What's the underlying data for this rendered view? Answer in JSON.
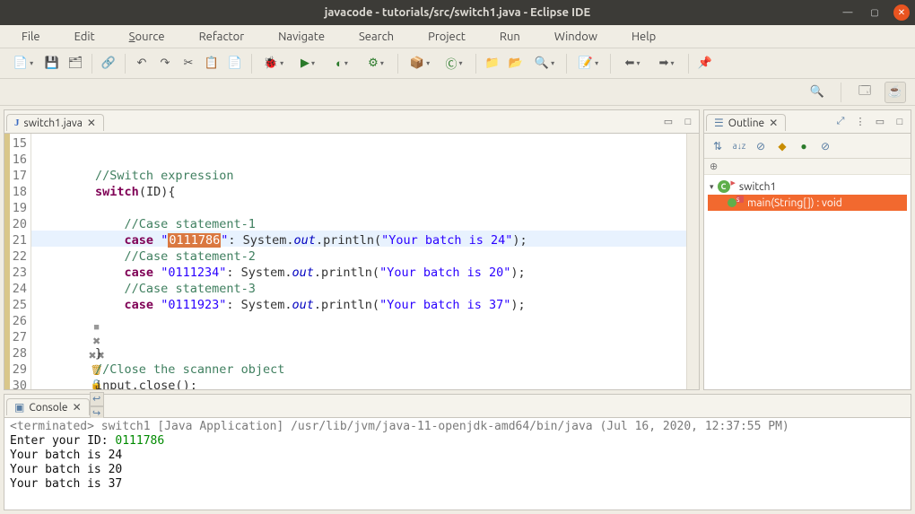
{
  "window": {
    "title": "javacode - tutorials/src/switch1.java - Eclipse IDE"
  },
  "menubar": {
    "file": "File",
    "edit": "Edit",
    "source": "Source",
    "refactor": "Refactor",
    "navigate": "Navigate",
    "search": "Search",
    "project": "Project",
    "run": "Run",
    "window": "Window",
    "help": "Help"
  },
  "editor": {
    "tab_filename": "switch1.java",
    "line_numbers": [
      "15",
      "16",
      "17",
      "18",
      "19",
      "20",
      "21",
      "22",
      "23",
      "24",
      "25",
      "26",
      "27",
      "28",
      "29",
      "30"
    ],
    "code_lines": [
      {
        "indent": "",
        "segments": []
      },
      {
        "indent": "",
        "segments": []
      },
      {
        "indent": "        ",
        "segments": [
          {
            "cls": "c-comm",
            "text": "//Switch expression"
          }
        ]
      },
      {
        "indent": "        ",
        "segments": [
          {
            "cls": "c-kw",
            "text": "switch"
          },
          {
            "cls": "",
            "text": "(ID){"
          }
        ]
      },
      {
        "indent": "",
        "segments": []
      },
      {
        "indent": "            ",
        "segments": [
          {
            "cls": "c-comm",
            "text": "//Case statement-1"
          }
        ]
      },
      {
        "indent": "            ",
        "segments": [
          {
            "cls": "c-kw",
            "text": "case"
          },
          {
            "cls": "",
            "text": " "
          },
          {
            "cls": "c-str",
            "text": "\""
          },
          {
            "cls": "c-sel",
            "text": "0111786"
          },
          {
            "cls": "c-str",
            "text": "\""
          },
          {
            "cls": "",
            "text": ": System."
          },
          {
            "cls": "c-field",
            "text": "out"
          },
          {
            "cls": "",
            "text": ".println("
          },
          {
            "cls": "c-str",
            "text": "\"Your batch is 24\""
          },
          {
            "cls": "",
            "text": ");"
          }
        ]
      },
      {
        "indent": "            ",
        "segments": [
          {
            "cls": "c-comm",
            "text": "//Case statement-2"
          }
        ]
      },
      {
        "indent": "            ",
        "segments": [
          {
            "cls": "c-kw",
            "text": "case"
          },
          {
            "cls": "",
            "text": " "
          },
          {
            "cls": "c-str",
            "text": "\"0111234\""
          },
          {
            "cls": "",
            "text": ": System."
          },
          {
            "cls": "c-field",
            "text": "out"
          },
          {
            "cls": "",
            "text": ".println("
          },
          {
            "cls": "c-str",
            "text": "\"Your batch is 20\""
          },
          {
            "cls": "",
            "text": ");"
          }
        ]
      },
      {
        "indent": "            ",
        "segments": [
          {
            "cls": "c-comm",
            "text": "//Case statement-3"
          }
        ]
      },
      {
        "indent": "            ",
        "segments": [
          {
            "cls": "c-kw",
            "text": "case"
          },
          {
            "cls": "",
            "text": " "
          },
          {
            "cls": "c-str",
            "text": "\"0111923\""
          },
          {
            "cls": "",
            "text": ": System."
          },
          {
            "cls": "c-field",
            "text": "out"
          },
          {
            "cls": "",
            "text": ".println("
          },
          {
            "cls": "c-str",
            "text": "\"Your batch is 37\""
          },
          {
            "cls": "",
            "text": ");"
          }
        ]
      },
      {
        "indent": "",
        "segments": []
      },
      {
        "indent": "",
        "segments": []
      },
      {
        "indent": "        ",
        "segments": [
          {
            "cls": "",
            "text": "}"
          }
        ]
      },
      {
        "indent": "        ",
        "segments": [
          {
            "cls": "c-comm",
            "text": "//Close the scanner object"
          }
        ]
      },
      {
        "indent": "        ",
        "segments": [
          {
            "cls": "",
            "text": "input.close();"
          }
        ]
      }
    ],
    "highlighted_line_index": 6
  },
  "outline": {
    "title": "Outline",
    "class_name": "switch1",
    "method_name": "main(String[]) : void"
  },
  "console": {
    "title": "Console",
    "status_line": "<terminated> switch1 [Java Application] /usr/lib/jvm/java-11-openjdk-amd64/bin/java (Jul 16, 2020, 12:37:55 PM)",
    "lines": [
      {
        "prefix": "Enter your ID: ",
        "value": "0111786"
      },
      {
        "prefix": "Your batch is 24",
        "value": ""
      },
      {
        "prefix": "Your batch is 20",
        "value": ""
      },
      {
        "prefix": "Your batch is 37",
        "value": ""
      }
    ]
  }
}
